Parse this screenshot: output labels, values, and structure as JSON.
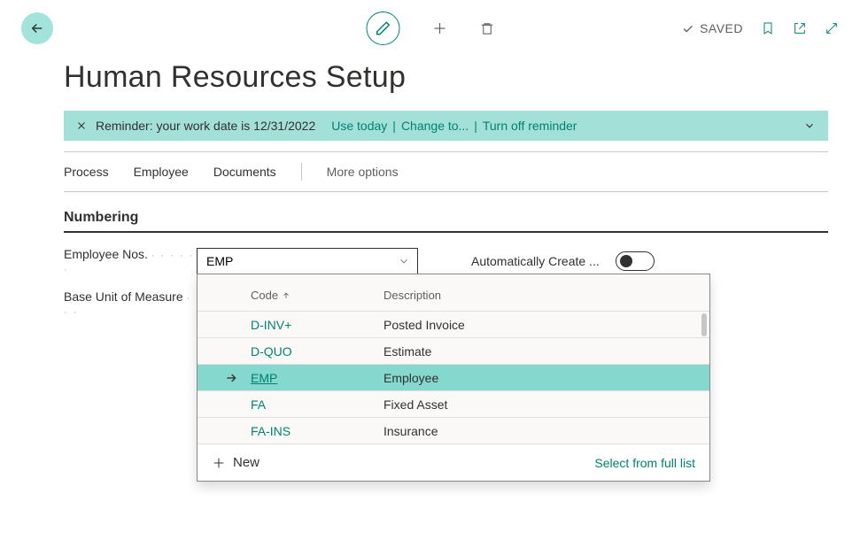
{
  "toolbar": {
    "saved_label": "SAVED"
  },
  "page_title": "Human Resources Setup",
  "reminder": {
    "text": "Reminder: your work date is 12/31/2022",
    "use_today": "Use today",
    "change_to": "Change to...",
    "turn_off": "Turn off reminder"
  },
  "actions": {
    "process": "Process",
    "employee": "Employee",
    "documents": "Documents",
    "more": "More options"
  },
  "section": "Numbering",
  "fields": {
    "employee_nos_label": "Employee Nos.",
    "employee_nos_value": "EMP",
    "base_uom_label": "Base Unit of Measure",
    "auto_create_label": "Automatically Create ..."
  },
  "dropdown": {
    "col_code": "Code",
    "col_desc": "Description",
    "rows": [
      {
        "code": "D-INV+",
        "desc": "Posted Invoice",
        "selected": false
      },
      {
        "code": "D-QUO",
        "desc": "Estimate",
        "selected": false
      },
      {
        "code": "EMP",
        "desc": "Employee",
        "selected": true
      },
      {
        "code": "FA",
        "desc": "Fixed Asset",
        "selected": false
      },
      {
        "code": "FA-INS",
        "desc": "Insurance",
        "selected": false
      }
    ],
    "new_label": "New",
    "full_list": "Select from full list"
  }
}
